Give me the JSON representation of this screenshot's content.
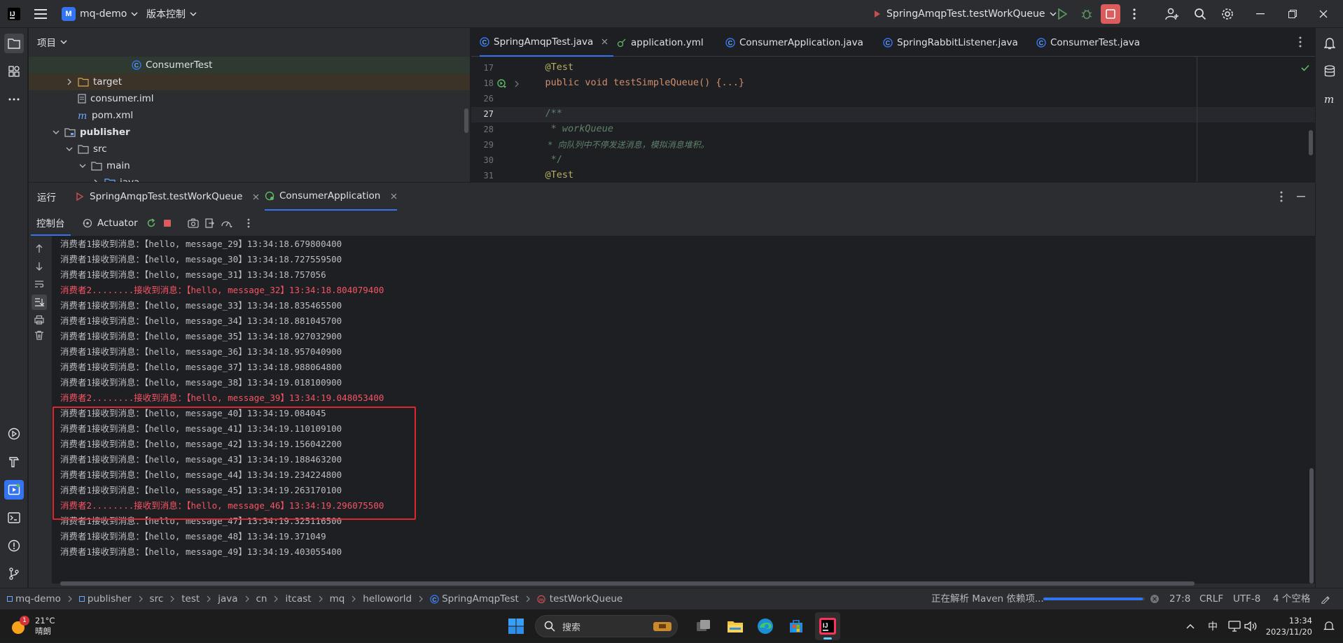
{
  "titlebar": {
    "project_badge": "M",
    "project_name": "mq-demo",
    "vcs_label": "版本控制",
    "run_config": "SpringAmqpTest.testWorkQueue"
  },
  "project_panel": {
    "title": "项目",
    "tree": [
      {
        "label": "ConsumerTest",
        "icon": "class-icon"
      },
      {
        "label": "target",
        "icon": "folder-icon"
      },
      {
        "label": "consumer.iml",
        "icon": "file-icon"
      },
      {
        "label": "pom.xml",
        "icon": "maven-icon"
      },
      {
        "label": "publisher",
        "icon": "module-icon"
      },
      {
        "label": "src",
        "icon": "folder-icon"
      },
      {
        "label": "main",
        "icon": "folder-icon"
      },
      {
        "label": "java",
        "icon": "folder-icon"
      }
    ]
  },
  "editor": {
    "tabs": [
      {
        "label": "SpringAmqpTest.java"
      },
      {
        "label": "application.yml"
      },
      {
        "label": "ConsumerApplication.java"
      },
      {
        "label": "SpringRabbitListener.java"
      },
      {
        "label": "ConsumerTest.java"
      }
    ],
    "lines": [
      {
        "num": "17",
        "text": "    @Test"
      },
      {
        "num": "18",
        "text": "    public void testSimpleQueue() {...}"
      },
      {
        "num": "26",
        "text": ""
      },
      {
        "num": "27",
        "text": "    /**"
      },
      {
        "num": "28",
        "text": "     * workQueue"
      },
      {
        "num": "29",
        "text": "     * 向队列中不停发送消息，模拟消息堆积。"
      },
      {
        "num": "30",
        "text": "     */"
      },
      {
        "num": "31",
        "text": "    @Test"
      }
    ]
  },
  "run_panel": {
    "title": "运行",
    "tabs": [
      {
        "label": "SpringAmqpTest.testWorkQueue"
      },
      {
        "label": "ConsumerApplication"
      }
    ],
    "subtabs": [
      {
        "label": "控制台"
      },
      {
        "label": "Actuator"
      }
    ],
    "console_lines": [
      {
        "text": "消费者1接收到消息：【hello, message_29】13:34:18.679800400",
        "color": "normal"
      },
      {
        "text": "消费者1接收到消息：【hello, message_30】13:34:18.727559500",
        "color": "normal"
      },
      {
        "text": "消费者1接收到消息：【hello, message_31】13:34:18.757056",
        "color": "normal"
      },
      {
        "text": "消费者2........接收到消息：【hello, message_32】13:34:18.804079400",
        "color": "red"
      },
      {
        "text": "消费者1接收到消息：【hello, message_33】13:34:18.835465500",
        "color": "normal"
      },
      {
        "text": "消费者1接收到消息：【hello, message_34】13:34:18.881045700",
        "color": "normal"
      },
      {
        "text": "消费者1接收到消息：【hello, message_35】13:34:18.927032900",
        "color": "normal"
      },
      {
        "text": "消费者1接收到消息：【hello, message_36】13:34:18.957040900",
        "color": "normal"
      },
      {
        "text": "消费者1接收到消息：【hello, message_37】13:34:18.988064800",
        "color": "normal"
      },
      {
        "text": "消费者1接收到消息：【hello, message_38】13:34:19.018100900",
        "color": "normal"
      },
      {
        "text": "消费者2........接收到消息：【hello, message_39】13:34:19.048053400",
        "color": "red"
      },
      {
        "text": "消费者1接收到消息：【hello, message_40】13:34:19.084045",
        "color": "normal"
      },
      {
        "text": "消费者1接收到消息：【hello, message_41】13:34:19.110109100",
        "color": "normal"
      },
      {
        "text": "消费者1接收到消息：【hello, message_42】13:34:19.156042200",
        "color": "normal"
      },
      {
        "text": "消费者1接收到消息：【hello, message_43】13:34:19.188463200",
        "color": "normal"
      },
      {
        "text": "消费者1接收到消息：【hello, message_44】13:34:19.234224800",
        "color": "normal"
      },
      {
        "text": "消费者1接收到消息：【hello, message_45】13:34:19.263170100",
        "color": "normal"
      },
      {
        "text": "消费者2........接收到消息：【hello, message_46】13:34:19.296075500",
        "color": "red"
      },
      {
        "text": "消费者1接收到消息：【hello, message_47】13:34:19.325116500",
        "color": "normal"
      },
      {
        "text": "消费者1接收到消息：【hello, message_48】13:34:19.371049",
        "color": "normal"
      },
      {
        "text": "消费者1接收到消息：【hello, message_49】13:34:19.403055400",
        "color": "normal"
      }
    ]
  },
  "statusbar": {
    "breadcrumb": [
      "mq-demo",
      "publisher",
      "src",
      "test",
      "java",
      "cn",
      "itcast",
      "mq",
      "helloworld",
      "SpringAmqpTest",
      "testWorkQueue"
    ],
    "task": "正在解析 Maven 依赖项...",
    "task_progress": 0.98,
    "position": "27:8",
    "line_sep": "CRLF",
    "encoding": "UTF-8",
    "indent": "4 个空格"
  },
  "taskbar": {
    "weather_temp": "21°C",
    "weather_desc": "晴朗",
    "weather_badge": "1",
    "search_label": "搜索",
    "ime": "中",
    "time": "13:34",
    "date": "2023/11/20"
  },
  "colors": {
    "accent": "#3574f0",
    "error_red": "#f75464",
    "highlight_box": "#e0262d"
  }
}
